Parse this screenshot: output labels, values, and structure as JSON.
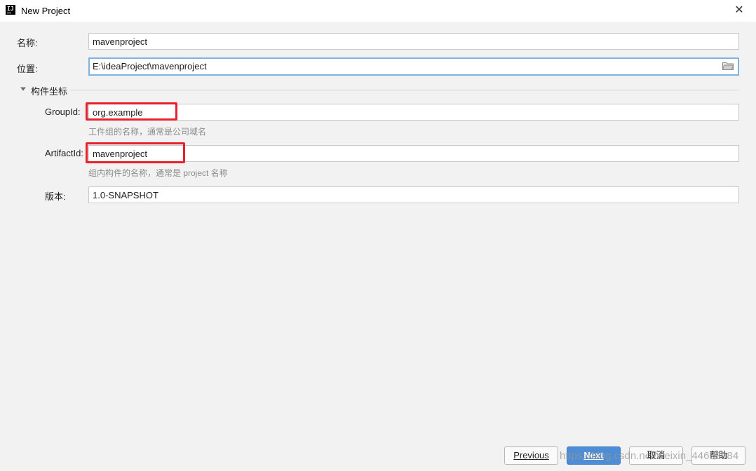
{
  "window": {
    "title": "New Project",
    "app_icon_text": "IJ",
    "close_glyph": "✕"
  },
  "form": {
    "name_label": "名称:",
    "name_value": "mavenproject",
    "location_label": "位置:",
    "location_value": "E:\\ideaProject\\mavenproject",
    "section_title": "构件坐标",
    "groupid_label": "GroupId:",
    "groupid_value": "org.example",
    "groupid_hint": "工件组的名称，通常是公司域名",
    "artifactid_label": "ArtifactId:",
    "artifactid_value": "mavenproject",
    "artifactid_hint": "组内构件的名称，通常是 project 名称",
    "version_label": "版本:",
    "version_value": "1.0-SNAPSHOT"
  },
  "buttons": {
    "previous": "Previous",
    "next": "Next",
    "cancel": "取消",
    "help": "帮助"
  },
  "watermark": "https://blog.csdn.net/weixin_44653984",
  "colors": {
    "highlight": "#e8202a",
    "primary_button": "#4c8dd6",
    "focus_border": "#7eb3e0"
  },
  "icons": [
    "intellij-icon",
    "close-icon",
    "folder-icon",
    "chevron-down-icon"
  ]
}
